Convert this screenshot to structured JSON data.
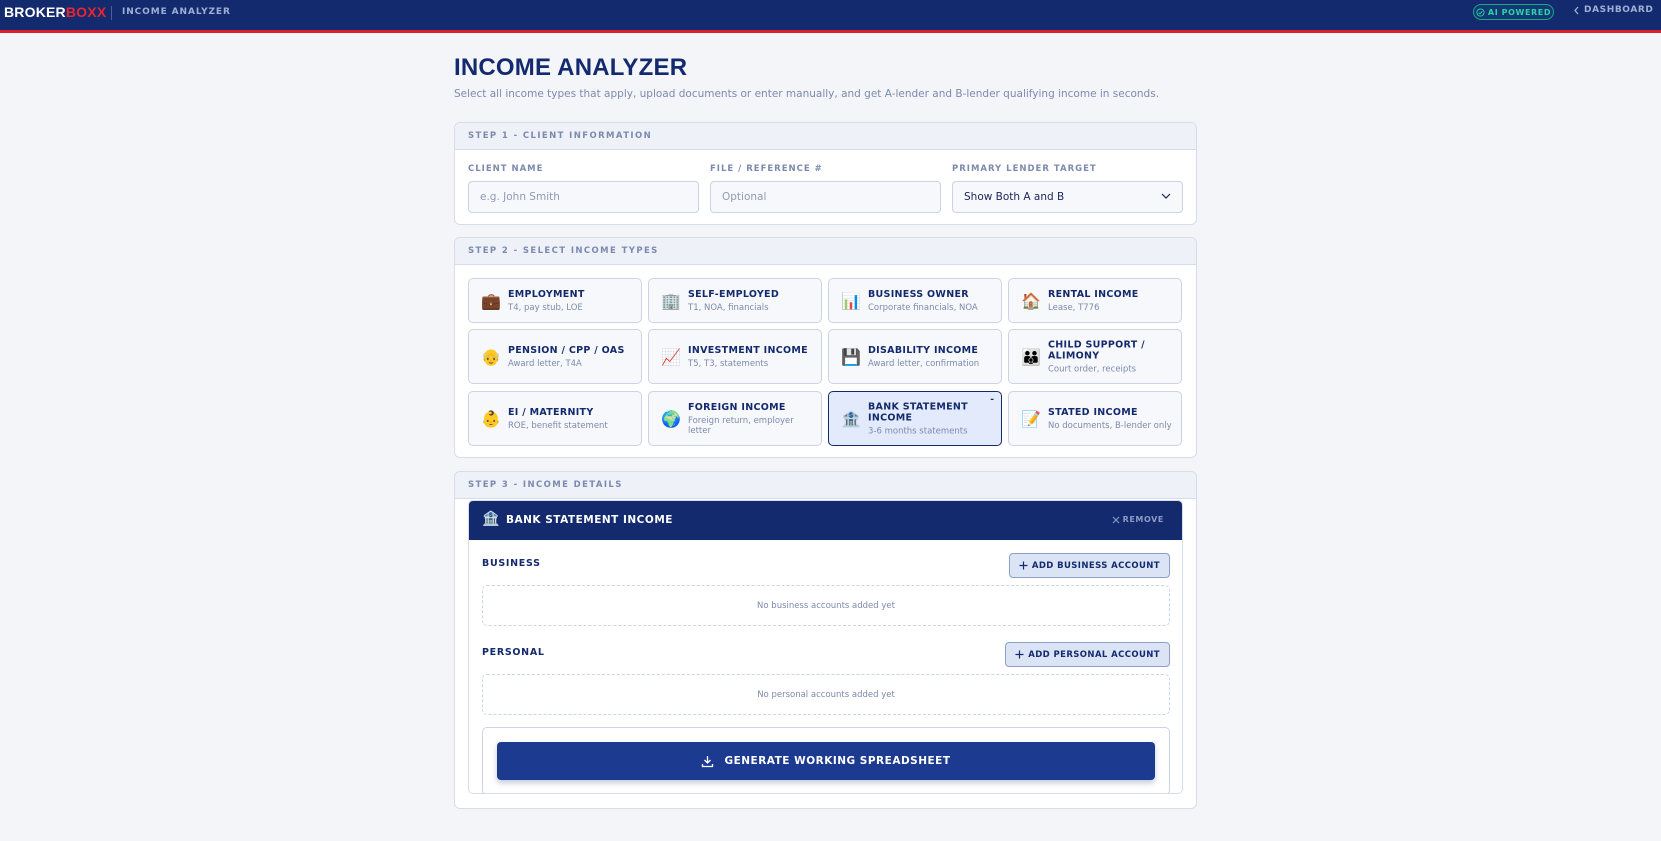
{
  "topbar": {
    "logo_part1": "BROKER",
    "logo_part2": "BOXX",
    "app_name": "INCOME ANALYZER",
    "ai_badge": "AI POWERED",
    "dashboard_link": "DASHBOARD"
  },
  "header": {
    "title": "INCOME ANALYZER",
    "subtitle": "Select all income types that apply, upload documents or enter manually, and get A-lender and B-lender qualifying income in seconds."
  },
  "step1": {
    "heading": "STEP 1 - CLIENT INFORMATION",
    "client_name_label": "CLIENT NAME",
    "client_name_placeholder": "e.g. John Smith",
    "file_ref_label": "FILE / REFERENCE #",
    "file_ref_placeholder": "Optional",
    "lender_label": "PRIMARY LENDER TARGET",
    "lender_value": "Show Both A and B"
  },
  "step2": {
    "heading": "STEP 2 - SELECT INCOME TYPES",
    "types": [
      {
        "name": "EMPLOYMENT",
        "sub": "T4, pay stub, LOE",
        "icon": "briefcase-icon",
        "emoji": "💼"
      },
      {
        "name": "SELF-EMPLOYED",
        "sub": "T1, NOA, financials",
        "icon": "office-building-icon",
        "emoji": "🏢"
      },
      {
        "name": "BUSINESS OWNER",
        "sub": "Corporate financials, NOA",
        "icon": "bar-chart-icon",
        "emoji": "📊"
      },
      {
        "name": "RENTAL INCOME",
        "sub": "Lease, T776",
        "icon": "house-icon",
        "emoji": "🏠"
      },
      {
        "name": "PENSION / CPP / OAS",
        "sub": "Award letter, T4A",
        "icon": "elder-icon",
        "emoji": "👴"
      },
      {
        "name": "INVESTMENT INCOME",
        "sub": "T5, T3, statements",
        "icon": "trend-chart-icon",
        "emoji": "📈"
      },
      {
        "name": "DISABILITY INCOME",
        "sub": "Award letter, confirmation",
        "icon": "floppy-disk-icon",
        "emoji": "💾"
      },
      {
        "name": "CHILD SUPPORT / ALIMONY",
        "sub": "Court order, receipts",
        "icon": "family-icon",
        "emoji": "👪"
      },
      {
        "name": "EI / MATERNITY",
        "sub": "ROE, benefit statement",
        "icon": "baby-icon",
        "emoji": "👶"
      },
      {
        "name": "FOREIGN INCOME",
        "sub": "Foreign return, employer letter",
        "icon": "globe-icon",
        "emoji": "🌍"
      },
      {
        "name": "BANK STATEMENT INCOME",
        "sub": "3-6 months statements",
        "icon": "bank-icon",
        "emoji": "🏦",
        "selected": true,
        "mark": "-"
      },
      {
        "name": "STATED INCOME",
        "sub": "No documents, B-lender only",
        "icon": "memo-icon",
        "emoji": "📝"
      }
    ]
  },
  "step3": {
    "heading": "STEP 3 - INCOME DETAILS",
    "panel_title": "BANK STATEMENT INCOME",
    "panel_icon": "bank-icon",
    "panel_emoji": "🏦",
    "remove_label": "REMOVE",
    "business_label": "BUSINESS",
    "add_business_label": "ADD BUSINESS ACCOUNT",
    "business_empty": "No business accounts added yet",
    "personal_label": "PERSONAL",
    "add_personal_label": "ADD PERSONAL ACCOUNT",
    "personal_empty": "No personal accounts added yet",
    "generate_label": "GENERATE WORKING SPREADSHEET"
  },
  "colors": {
    "navy": "#142a6e",
    "accent_red": "#e8262f",
    "ai_teal": "#2fd0b0",
    "button_blue": "#1c3a8f"
  }
}
